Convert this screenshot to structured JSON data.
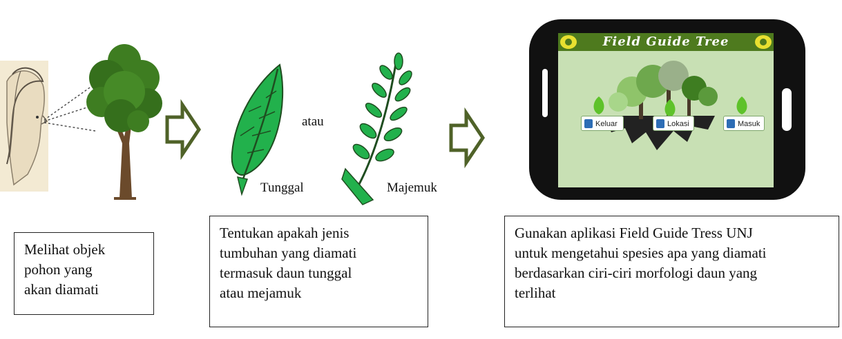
{
  "labels": {
    "atau": "atau",
    "tunggal": "Tunggal",
    "majemuk": "Majemuk"
  },
  "boxes": {
    "step1": "Melihat objek\npohon yang\nakan diamati",
    "step2": "Tentukan apakah jenis\ntumbuhan yang diamati\ntermasuk daun tunggal\natau mejamuk",
    "step3": "Gunakan aplikasi  Field Guide Tress UNJ\nuntuk mengetahui spesies apa yang diamati\nberdasarkan ciri-ciri  morfologi daun yang\nterlihat"
  },
  "phone": {
    "title": "Field Guide Tree",
    "buttons": [
      "Keluar",
      "Lokasi",
      "Masuk"
    ]
  },
  "colors": {
    "arrow_fill": "#ffffff",
    "arrow_stroke": "#4f6228",
    "leaf": "#22b14c",
    "tree": "#3e7d21",
    "phone_body": "#111111",
    "screen": "#c8e0b4"
  }
}
